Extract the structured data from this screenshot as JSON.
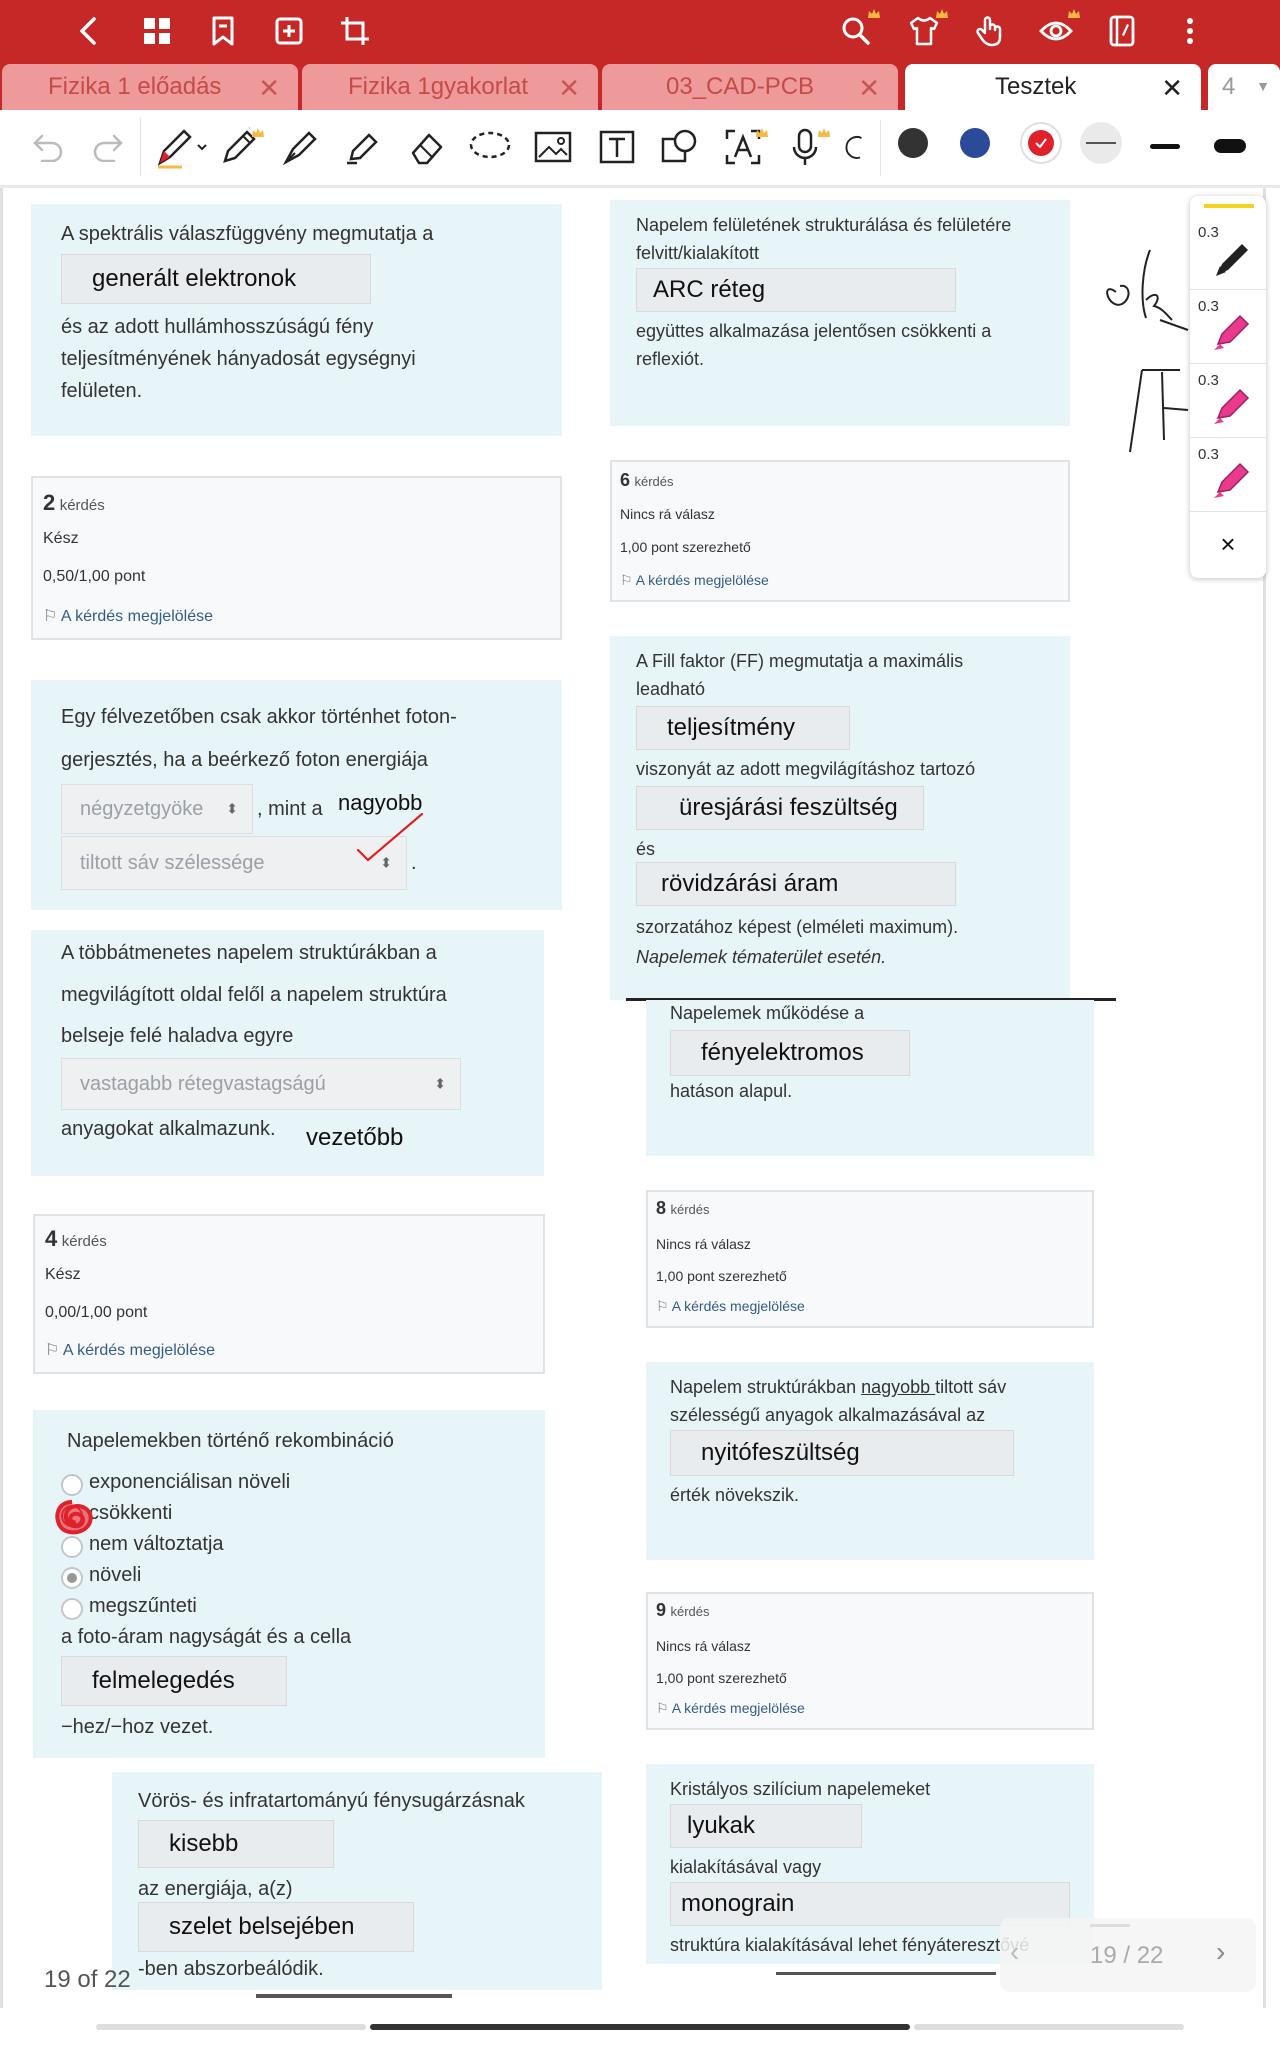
{
  "topbar": {
    "icons": [
      "back-arrow-icon",
      "grid-icon",
      "bookmark-icon",
      "add-page-icon",
      "crop-icon",
      "search-icon",
      "shirt-icon",
      "hand-touch-icon",
      "eye-icon",
      "notebook-icon",
      "more-vertical-icon"
    ],
    "accent": "#c62828"
  },
  "tabs": [
    {
      "label": "Fizika 1 előadás"
    },
    {
      "label": "Fizika 1gyakorlat"
    },
    {
      "label": "03_CAD-PCB"
    },
    {
      "label": "Tesztek"
    }
  ],
  "tabs_count": "4",
  "toolbar": {
    "tools": [
      "undo-icon",
      "redo-icon",
      "pen-tool-icon",
      "pencil-icon",
      "fountain-pen-icon",
      "highlighter-icon",
      "eraser-icon",
      "lasso-icon",
      "image-icon",
      "text-icon",
      "shapes-icon",
      "ocr-icon",
      "microphone-icon",
      "lasso-shape-icon"
    ],
    "colors": [
      "#333333",
      "#2c4a9a",
      "#e0202a"
    ]
  },
  "pen_panel": {
    "sizes": [
      "0.3",
      "0.3",
      "0.3",
      "0.3"
    ],
    "colors": [
      "#222222",
      "#e93a8d",
      "#e93a8d",
      "#e93a8d"
    ],
    "close": "×"
  },
  "left": {
    "q1_text1": "A spektrális válaszfüggvény megmutatja a",
    "q1_answer": "generált elektronok",
    "q1_text2a": "és az adott hullámhosszúságú fény",
    "q1_text2b": "teljesítményének hányadosát egységnyi",
    "q1_text2c": "felületen.",
    "q2_num": "2",
    "q2_label": "kérdés",
    "q2_status": "Kész",
    "q2_points": "0,50/1,00 pont",
    "q2_flag": "A kérdés megjelölése",
    "q3_text1": "Egy félvezetőben csak akkor történhet foton-",
    "q3_text2": "gerjesztés, ha a beérkező foton energiája",
    "q3_select1": "négyzetgyöke",
    "q3_mint": ", mint a",
    "q3_hand": "nagyobb",
    "q3_select2": "tiltott sáv szélessége",
    "q3_dot": ".",
    "q3b_text1": "A többátmenetes napelem struktúrákban a",
    "q3b_text2": "megvilágított oldal felől a napelem struktúra",
    "q3b_text3": "belseje felé haladva egyre",
    "q3b_select": "vastagabb rétegvastagságú",
    "q3b_text4": "anyagokat alkalmazunk.",
    "q3b_hand": "vezetőbb",
    "q4_num": "4",
    "q4_label": "kérdés",
    "q4_status": "Kész",
    "q4_points": "0,00/1,00 pont",
    "q4_flag": "A kérdés megjelölése",
    "q5_title": "Napelemekben történő rekombináció",
    "q5_options": [
      "exponenciálisan növeli",
      "csökkenti",
      "nem változtatja",
      "növeli",
      "megszűnteti"
    ],
    "q5_after": "a foto-áram nagyságát és a cella",
    "q5_answer": "felmelegedés",
    "q5_suffix": "−hez/−hoz vezet.",
    "q10_text1": "Vörös- és infratartományú fénysugárzásnak",
    "q10_answer1": "kisebb",
    "q10_text2": "az energiája, a(z)",
    "q10_answer2": "szelet belsejében",
    "q10_text3": "-ben abszorbeálódik."
  },
  "right": {
    "q5b_text1": "Napelem felületének strukturálása és felületére",
    "q5b_text2": "felvitt/kialakított",
    "q5b_answer": "ARC réteg",
    "q5b_text3": "együttes alkalmazása jelentősen csökkenti a",
    "q5b_text4": "reflexiót.",
    "q6_num": "6",
    "q6_label": "kérdés",
    "q6_status": "Nincs rá válasz",
    "q6_points": "1,00 pont szerezhető",
    "q6_flag": "A kérdés megjelölése",
    "q7_text1": "A Fill faktor (FF) megmutatja a maximális",
    "q7_text2": "leadható",
    "q7_answer1": "teljesítmény",
    "q7_text3": "viszonyát az adott megvilágításhoz tartozó",
    "q7_answer2": "üresjárási feszültség",
    "q7_and": "és",
    "q7_answer3": "rövidzárási áram",
    "q7_text4": "szorzatához képest (elméleti maximum).",
    "q7_note": "Napelemek tématerület esetén.",
    "q7b_text1": "Napelemek működése a",
    "q7b_answer": "fényelektromos",
    "q7b_text2": "hatáson alapul.",
    "q8_num": "8",
    "q8_label": "kérdés",
    "q8_status": "Nincs rá válasz",
    "q8_points": "1,00 pont szerezhető",
    "q8_flag": "A kérdés megjelölése",
    "q8b_text1": "Napelem struktúrákban ",
    "q8b_under": "nagyobb ",
    "q8b_text1b": "tiltott sáv",
    "q8b_text2": "szélességű anyagok alkalmazásával az",
    "q8b_answer": "nyitófeszültség",
    "q8b_text3": "érték növekszik.",
    "q9_num": "9",
    "q9_label": "kérdés",
    "q9_status": "Nincs rá válasz",
    "q9_points": "1,00 pont szerezhető",
    "q9_flag": "A kérdés megjelölése",
    "q9b_text1": "Kristályos szilícium napelemeket",
    "q9b_answer1": "lyukak",
    "q9b_text2": "kialakításával vagy",
    "q9b_answer2": "monograin",
    "q9b_text3": "struktúra kialakításával lehet fényáteresztővé"
  },
  "pagination": {
    "left_label": "19 of 22",
    "right_label": "19 / 22"
  }
}
